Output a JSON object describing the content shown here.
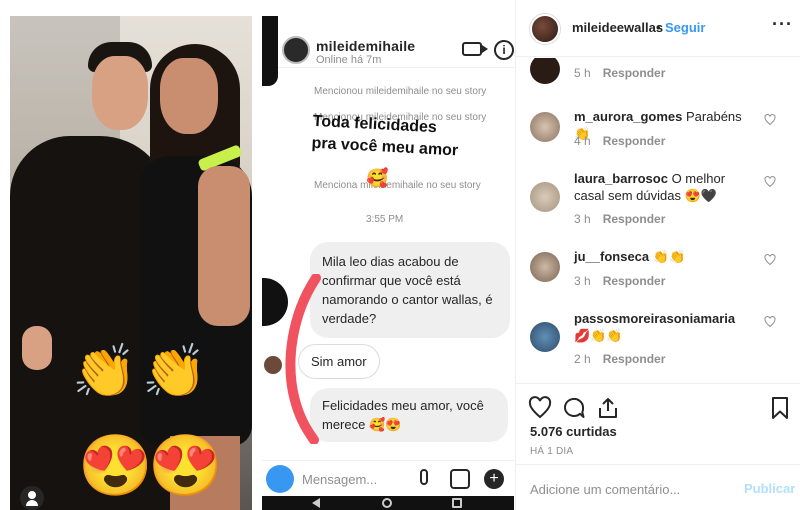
{
  "chat": {
    "username": "mileidemihaile",
    "status": "Online há 7m",
    "mention_1": "Mencionou mileidemihaile no seu story",
    "mention_2": "Mencionou mileidemihaile no seu story",
    "mention_3": "Menciona mileidemihaile no seu story",
    "story_line_1": "Toda felicidades",
    "story_line_2": "pra você meu amor",
    "time": "3:55 PM",
    "message_1": "Mila leo dias acabou de confirmar que você está namorando o cantor wallas, é verdade?",
    "reply": "Sim amor",
    "message_2": "Felicidades meu amor, você merece 🥰😍",
    "input_placeholder": "Mensagem..."
  },
  "photo": {
    "emoji_clap": "👏",
    "emoji_heart_eyes": "😍"
  },
  "panel": {
    "username": "mileideewallas",
    "separator": "•",
    "follow_label": "Seguir",
    "more_label": "···",
    "comments": [
      {
        "user": "",
        "text": "",
        "time": "5 h",
        "reply": "Responder"
      },
      {
        "user": "m_aurora_gomes",
        "text": "Parabéns 👏",
        "time": "4 h",
        "reply": "Responder"
      },
      {
        "user": "laura_barrosoc",
        "text": "O melhor casal sem dúvidas 😍🖤",
        "time": "3 h",
        "reply": "Responder"
      },
      {
        "user": "ju__fonseca",
        "text": "👏👏",
        "time": "3 h",
        "reply": "Responder"
      },
      {
        "user": "passosmoreirasoniamaria",
        "text": "💋👏👏",
        "time": "2 h",
        "reply": "Responder"
      }
    ],
    "likes": "5.076 curtidas",
    "date": "HÁ 1 DIA",
    "comment_placeholder": "Adicione um comentário...",
    "publish_label": "Publicar"
  },
  "colors": {
    "accent": "#3897f0",
    "publish_disabled": "#b2dffc",
    "muted": "#8e8e8e",
    "text": "#262626"
  }
}
